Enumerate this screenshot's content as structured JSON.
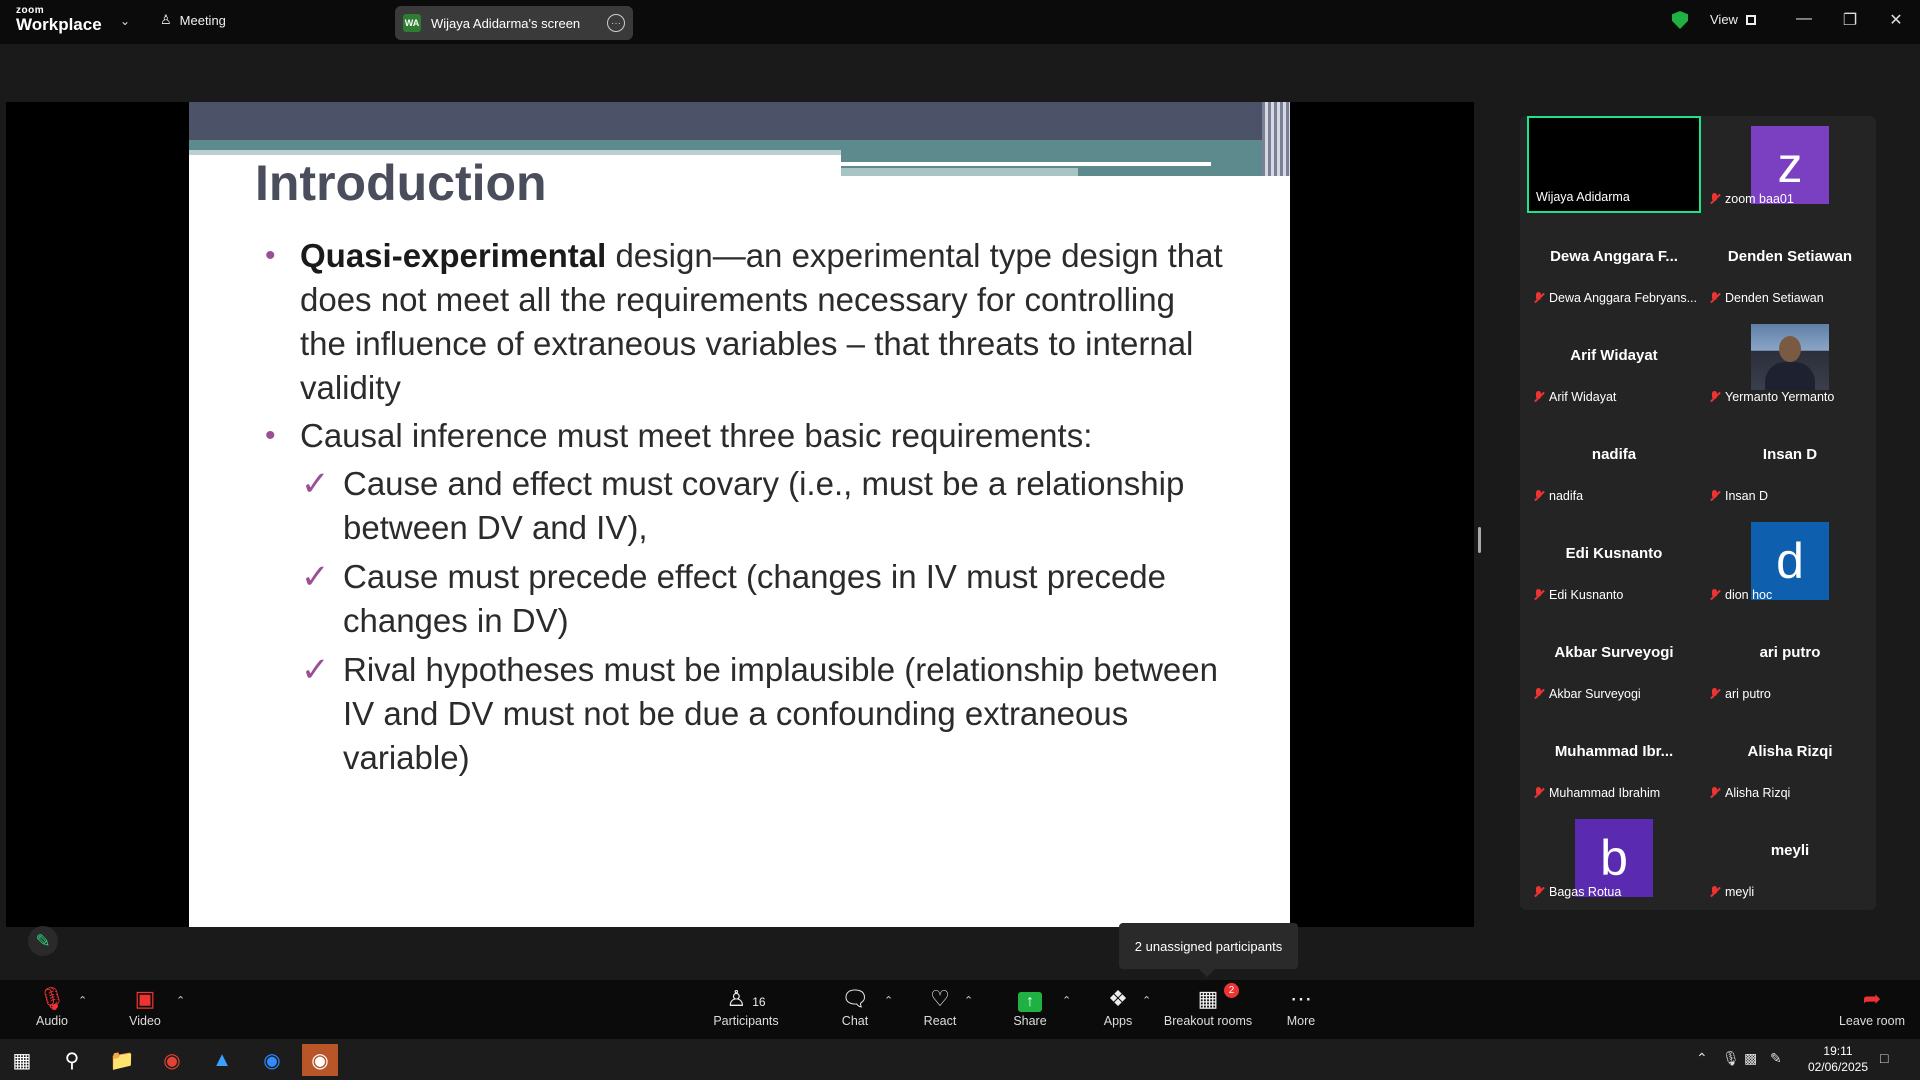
{
  "app": {
    "logo_small": "zoom",
    "logo_big": "Workplace",
    "meeting_label": "Meeting",
    "screen_share_initials": "WA",
    "screen_share_label": "Wijaya Adidarma's screen",
    "view_label": "View"
  },
  "slide": {
    "title": "Introduction",
    "bullet1_bold": "Quasi-experimental",
    "bullet1_rest": " design—an experimental type design that does not meet all the requirements necessary for controlling the influence of extraneous variables – that threats to internal validity",
    "bullet2": "Causal inference must meet three basic requirements:",
    "checks": [
      "Cause and effect must covary (i.e., must be a relationship between DV and IV),",
      "Cause must precede effect (changes in IV must precede changes in DV)",
      "Rival hypotheses must be implausible (relationship between IV and DV must not be due a confounding extraneous variable)"
    ],
    "check_mark": "✓"
  },
  "gallery": {
    "tiles": [
      {
        "center": "",
        "caption": "Wijaya Adidarma",
        "muted": false,
        "active": true
      },
      {
        "center": "",
        "caption": "zoom baa01",
        "muted": true,
        "avatar": "z",
        "avatar_color": "#7b3fc1"
      },
      {
        "center": "Dewa Anggara F...",
        "caption": "Dewa Anggara Febryans...",
        "muted": true
      },
      {
        "center": "Denden Setiawan",
        "caption": "Denden Setiawan",
        "muted": true
      },
      {
        "center": "Arif Widayat",
        "caption": "Arif Widayat",
        "muted": true
      },
      {
        "center": "",
        "caption": "Yermanto Yermanto",
        "muted": true,
        "photo": true
      },
      {
        "center": "nadifa",
        "caption": "nadifa",
        "muted": true
      },
      {
        "center": "Insan D",
        "caption": "Insan D",
        "muted": true
      },
      {
        "center": "Edi Kusnanto",
        "caption": "Edi Kusnanto",
        "muted": true
      },
      {
        "center": "",
        "caption": "dion hoc",
        "muted": true,
        "avatar": "d",
        "avatar_color": "#0e5fad"
      },
      {
        "center": "Akbar Surveyogi",
        "caption": "Akbar Surveyogi",
        "muted": true
      },
      {
        "center": "ari putro",
        "caption": "ari putro",
        "muted": true
      },
      {
        "center": "Muhammad Ibr...",
        "caption": "Muhammad Ibrahim",
        "muted": true
      },
      {
        "center": "Alisha Rizqi",
        "caption": "Alisha Rizqi",
        "muted": true
      },
      {
        "center": "",
        "caption": "Bagas Rotua",
        "muted": true,
        "avatar": "b",
        "avatar_color": "#5a2ab0"
      },
      {
        "center": "meyli",
        "caption": "meyli",
        "muted": true
      }
    ]
  },
  "tooltip": "2 unassigned participants",
  "toolbar": {
    "audio": "Audio",
    "video": "Video",
    "participants": "Participants",
    "participants_count": "16",
    "chat": "Chat",
    "react": "React",
    "share": "Share",
    "apps": "Apps",
    "breakout": "Breakout rooms",
    "breakout_badge": "2",
    "more": "More",
    "leave": "Leave room"
  },
  "taskbar": {
    "time": "19:11",
    "date": "02/06/2025"
  },
  "colors": {
    "accent_green": "#1fe38a",
    "mute_red": "#ee3333",
    "bullet_purple": "#9b4f96"
  }
}
